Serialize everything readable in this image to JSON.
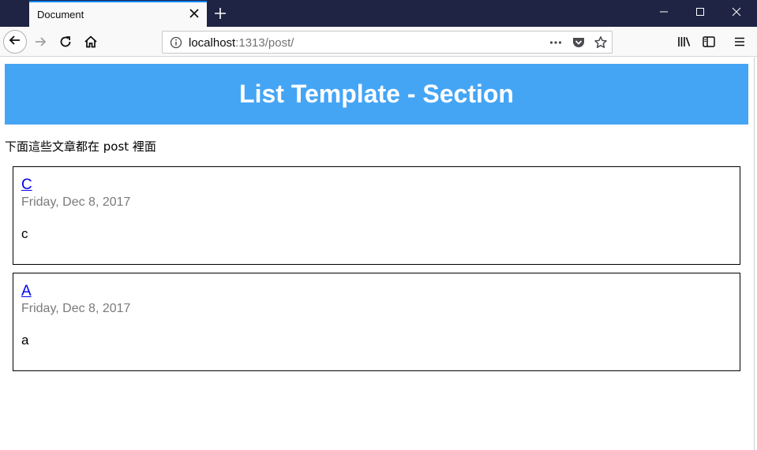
{
  "browser": {
    "tab_title": "Document",
    "url_host": "localhost",
    "url_path": ":1313/post/"
  },
  "page": {
    "header_title": "List Template - Section",
    "intro": "下面這些文章都在 post 裡面",
    "posts": [
      {
        "title": "C",
        "date": "Friday, Dec 8, 2017",
        "summary": "c"
      },
      {
        "title": "A",
        "date": "Friday, Dec 8, 2017",
        "summary": "a"
      }
    ]
  },
  "colors": {
    "titlebar": "#1f2444",
    "header_banner": "#45a5f5",
    "link": "#0000ee"
  },
  "icons": {
    "tab_close": "close-icon",
    "new_tab": "plus-icon",
    "back": "arrow-left-icon",
    "forward": "arrow-right-icon",
    "reload": "reload-icon",
    "home": "home-icon",
    "site_info": "info-icon",
    "page_actions": "more-horizontal-icon",
    "pocket": "pocket-icon",
    "bookmark": "star-icon",
    "library": "library-icon",
    "sidebar": "sidebar-icon",
    "menu": "hamburger-menu-icon",
    "minimize": "minimize-icon",
    "maximize": "maximize-icon",
    "close_window": "close-window-icon"
  }
}
